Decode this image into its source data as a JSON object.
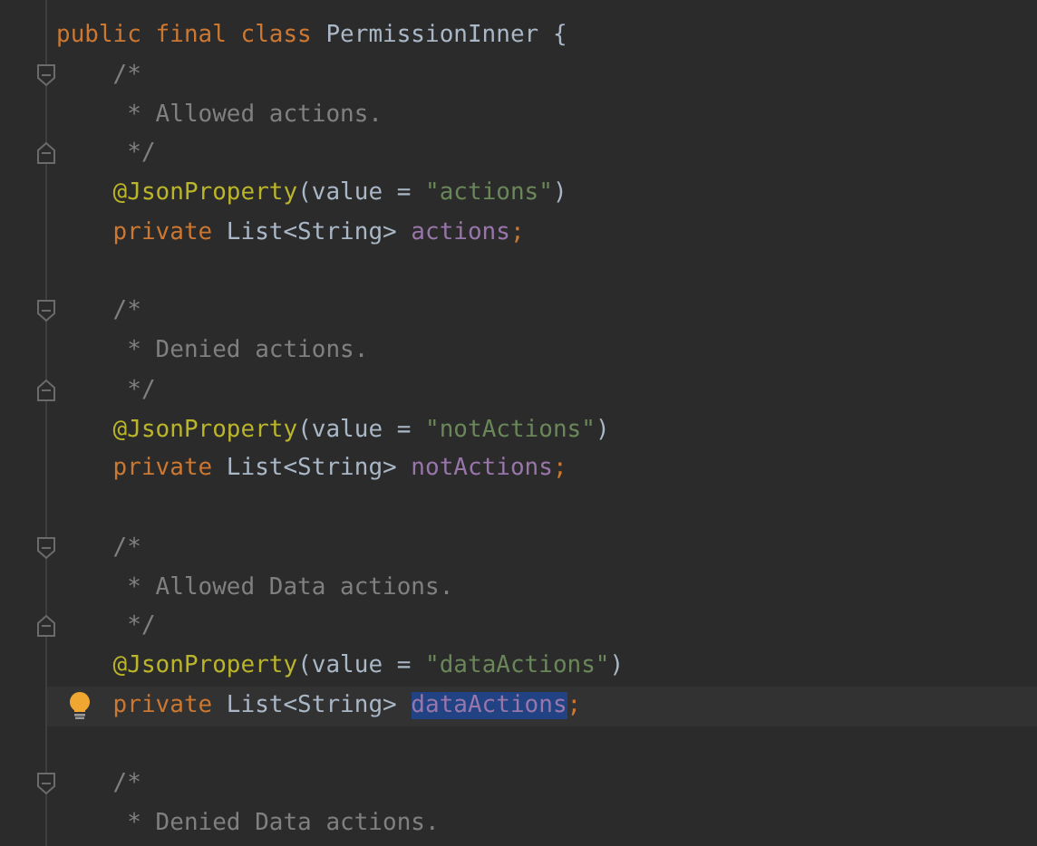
{
  "editor": {
    "lines": [
      {
        "kind": "code",
        "tokens": [
          {
            "kind": "keyword",
            "text": "public final class ",
            "selected": false
          },
          {
            "kind": "plain",
            "text": "PermissionInner {",
            "selected": false
          }
        ]
      },
      {
        "kind": "code",
        "fold_start": true,
        "tokens": [
          {
            "kind": "comment",
            "text": "    /*",
            "selected": false
          }
        ]
      },
      {
        "kind": "code",
        "tokens": [
          {
            "kind": "comment",
            "text": "     * Allowed actions.",
            "selected": false
          }
        ]
      },
      {
        "kind": "code",
        "fold_end": true,
        "tokens": [
          {
            "kind": "comment",
            "text": "     */",
            "selected": false
          }
        ]
      },
      {
        "kind": "code",
        "tokens": [
          {
            "kind": "annotation",
            "text": "    @JsonProperty",
            "selected": false
          },
          {
            "kind": "plain",
            "text": "(value = ",
            "selected": false
          },
          {
            "kind": "string",
            "text": "\"actions\"",
            "selected": false
          },
          {
            "kind": "plain",
            "text": ")",
            "selected": false
          }
        ]
      },
      {
        "kind": "code",
        "tokens": [
          {
            "kind": "keyword",
            "text": "    private ",
            "selected": false
          },
          {
            "kind": "plain",
            "text": "List<String> ",
            "selected": false
          },
          {
            "kind": "field",
            "text": "actions",
            "selected": false
          },
          {
            "kind": "keyword",
            "text": ";",
            "selected": false
          }
        ]
      },
      {
        "kind": "blank"
      },
      {
        "kind": "code",
        "fold_start": true,
        "tokens": [
          {
            "kind": "comment",
            "text": "    /*",
            "selected": false
          }
        ]
      },
      {
        "kind": "code",
        "tokens": [
          {
            "kind": "comment",
            "text": "     * Denied actions.",
            "selected": false
          }
        ]
      },
      {
        "kind": "code",
        "fold_end": true,
        "tokens": [
          {
            "kind": "comment",
            "text": "     */",
            "selected": false
          }
        ]
      },
      {
        "kind": "code",
        "tokens": [
          {
            "kind": "annotation",
            "text": "    @JsonProperty",
            "selected": false
          },
          {
            "kind": "plain",
            "text": "(value = ",
            "selected": false
          },
          {
            "kind": "string",
            "text": "\"notActions\"",
            "selected": false
          },
          {
            "kind": "plain",
            "text": ")",
            "selected": false
          }
        ]
      },
      {
        "kind": "code",
        "tokens": [
          {
            "kind": "keyword",
            "text": "    private ",
            "selected": false
          },
          {
            "kind": "plain",
            "text": "List<String> ",
            "selected": false
          },
          {
            "kind": "field",
            "text": "notActions",
            "selected": false
          },
          {
            "kind": "keyword",
            "text": ";",
            "selected": false
          }
        ]
      },
      {
        "kind": "blank"
      },
      {
        "kind": "code",
        "fold_start": true,
        "tokens": [
          {
            "kind": "comment",
            "text": "    /*",
            "selected": false
          }
        ]
      },
      {
        "kind": "code",
        "tokens": [
          {
            "kind": "comment",
            "text": "     * Allowed Data actions.",
            "selected": false
          }
        ]
      },
      {
        "kind": "code",
        "fold_end": true,
        "tokens": [
          {
            "kind": "comment",
            "text": "     */",
            "selected": false
          }
        ]
      },
      {
        "kind": "code",
        "tokens": [
          {
            "kind": "annotation",
            "text": "    @JsonProperty",
            "selected": false
          },
          {
            "kind": "plain",
            "text": "(value = ",
            "selected": false
          },
          {
            "kind": "string",
            "text": "\"dataActions\"",
            "selected": false
          },
          {
            "kind": "plain",
            "text": ")",
            "selected": false
          }
        ]
      },
      {
        "kind": "code",
        "current": true,
        "intention": true,
        "tokens": [
          {
            "kind": "keyword",
            "text": "    private ",
            "selected": false
          },
          {
            "kind": "plain",
            "text": "List<String> ",
            "selected": false
          },
          {
            "kind": "field",
            "text": "dataActions",
            "selected": true
          },
          {
            "kind": "keyword",
            "text": ";",
            "selected": false
          }
        ]
      },
      {
        "kind": "blank"
      },
      {
        "kind": "code",
        "fold_start": true,
        "tokens": [
          {
            "kind": "comment",
            "text": "    /*",
            "selected": false
          }
        ]
      },
      {
        "kind": "code",
        "tokens": [
          {
            "kind": "comment",
            "text": "     * Denied Data actions.",
            "selected": false
          }
        ]
      }
    ]
  }
}
